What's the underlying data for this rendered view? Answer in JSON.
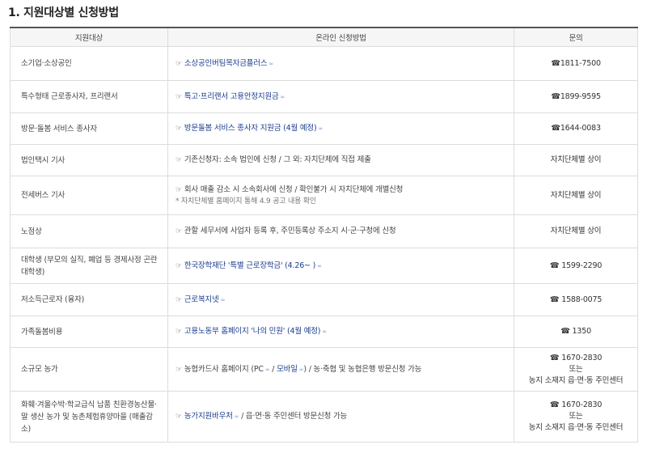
{
  "title": "1. 지원대상별 신청방법",
  "table": {
    "headers": [
      "지원대상",
      "온라인 신청방법",
      "문의"
    ],
    "rows": [
      {
        "target": "소기업·소상공인",
        "method": [
          {
            "t": "link",
            "v": "소상공인버팀목자금플러스"
          }
        ],
        "contact": [
          "☎1811-7500"
        ]
      },
      {
        "target": "특수형태 근로종사자, 프리랜서",
        "method": [
          {
            "t": "link",
            "v": "특고·프리랜서 고용안정지원금"
          }
        ],
        "contact": [
          "☎1899-9595"
        ]
      },
      {
        "target": "방문·돌봄 서비스 종사자",
        "method": [
          {
            "t": "link",
            "v": "방문돌봄 서비스 종사자 지원금 (4월 예정)"
          }
        ],
        "contact": [
          "☎1644-0083"
        ]
      },
      {
        "target": "법인택시 기사",
        "method": [
          {
            "t": "text",
            "v": "기존신청자: 소속 법인에 신청 / 그 외: 자치단체에 직접 제출"
          }
        ],
        "contact": [
          "자치단체별 상이"
        ]
      },
      {
        "target": "전세버스 기사",
        "method": [
          {
            "t": "text",
            "v": "회사 매출 감소 시 소속회사에 신청 / 확인불가 시 자치단체에 개별신청"
          }
        ],
        "note": "* 자치단체별 홈페이지 통해 4.9 공고 내용 확인",
        "contact": [
          "자치단체별 상이"
        ]
      },
      {
        "target": "노점상",
        "method": [
          {
            "t": "text",
            "v": "관할 세무서에 사업자 등록 후, 주민등록상 주소지 시·군·구청에 신청"
          }
        ],
        "contact": [
          "자치단체별 상이"
        ]
      },
      {
        "target": "대학생 (부모의 실직, 폐업 등 경제사정 곤란 대학생)",
        "method": [
          {
            "t": "link",
            "v": "한국장학재단 '특별 근로장학금' (4.26~ )"
          }
        ],
        "contact": [
          "☎ 1599-2290"
        ]
      },
      {
        "target": "저소득근로자 (융자)",
        "method": [
          {
            "t": "link",
            "v": "근로복지넷"
          }
        ],
        "contact": [
          "☎ 1588-0075"
        ]
      },
      {
        "target": "가족돌봄비용",
        "method": [
          {
            "t": "link",
            "v": "고용노동부 홈페이지 '나의 민원' (4월 예정)"
          }
        ],
        "contact": [
          "☎ 1350"
        ]
      },
      {
        "target": "소규모 농가",
        "method": [
          {
            "t": "text",
            "v": "농협카드사 홈페이지 (PC"
          },
          {
            "t": "link",
            "v": ""
          },
          {
            "t": "text",
            "v": " / "
          },
          {
            "t": "link",
            "v": "모바일"
          },
          {
            "t": "text",
            "v": ") / 농·축협 및 농협은행 방문신청 가능"
          }
        ],
        "contact": [
          "☎ 1670-2830",
          "또는",
          "농지 소재지 읍·면·동 주민센터"
        ]
      },
      {
        "target": "화훼·겨울수박·학교급식 납품 친환경농산물·말 생산 농가 및 농촌체험휴양마을 (매출감소)",
        "method": [
          {
            "t": "link",
            "v": "농가지원바우처"
          },
          {
            "t": "text",
            "v": " / 읍·면·동 주민센터 방문신청 가능"
          }
        ],
        "contact": [
          "☎ 1670-2830",
          "또는",
          "농지 소재지 읍·면·동 주민센터"
        ]
      }
    ]
  },
  "icons": {
    "pointer": "☞",
    "link": "∞",
    "phone": "☎"
  },
  "colors": {
    "link": "#1a3c8f",
    "header_bg": "#f6f6f6",
    "border": "#dcdcdc"
  }
}
